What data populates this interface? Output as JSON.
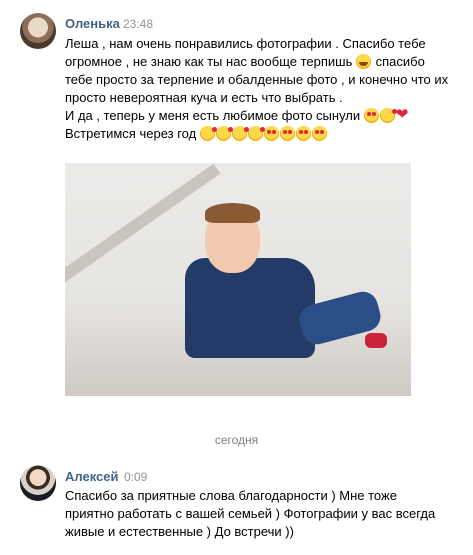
{
  "messages": [
    {
      "author": "Оленька",
      "time": "23:48",
      "lines": [
        "Леша , нам очень понравились фотографии . Спасибо тебе",
        "огромное , не знаю как ты нас вообще терпишь",
        "спасибо",
        "тебе просто за терпение и обалденные фото , и конечно что их",
        "просто невероятная куча и есть что выбрать .",
        "И да , теперь у меня есть любимое фото сынули",
        "Встретимся через год"
      ],
      "emoji_line2": "laugh-emoji",
      "emoji_line6": [
        "heart-eyes-emoji",
        "kiss-emoji",
        "heart-emoji"
      ],
      "emoji_line7": [
        "kiss-emoji",
        "kiss-emoji",
        "kiss-emoji",
        "kiss-emoji",
        "heart-eyes-emoji",
        "heart-eyes-emoji",
        "heart-eyes-emoji",
        "heart-eyes-emoji"
      ]
    },
    {
      "author": "Алексей",
      "time": "0:09",
      "lines": [
        "Спасибо за приятные слова благодарности ) Мне тоже",
        "приятно работать с вашей семьей ) Фотографии у вас всегда",
        "живые и естественные ) До встречи ))"
      ]
    }
  ],
  "date_divider": "сегодня"
}
